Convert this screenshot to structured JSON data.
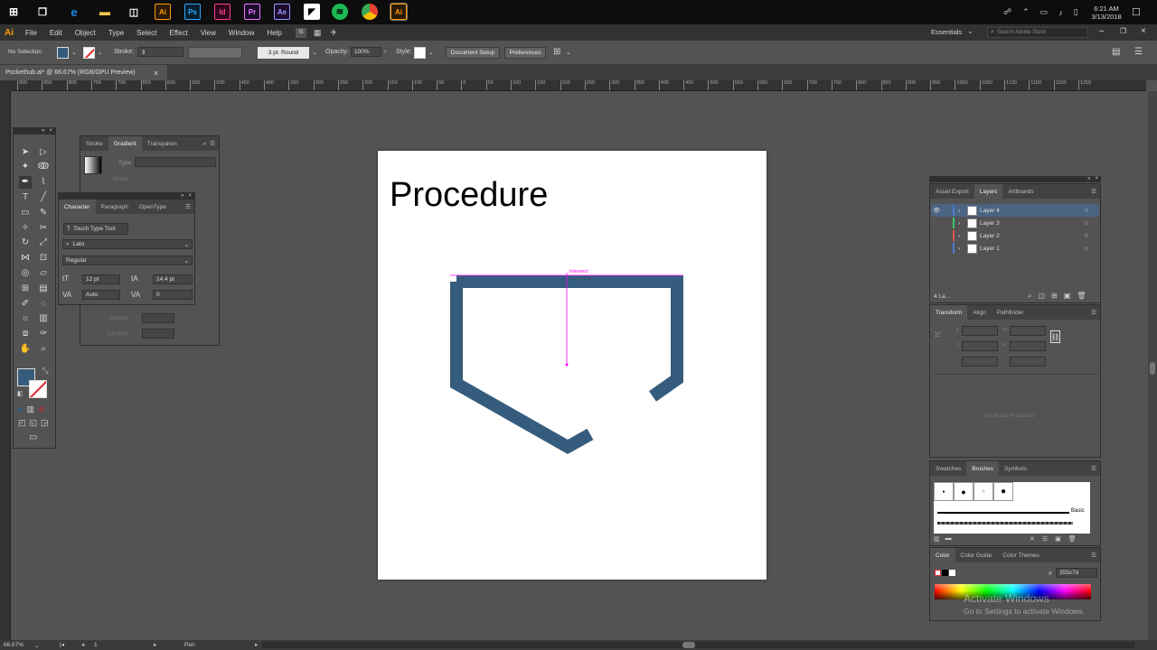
{
  "taskbar": {
    "apps": [
      "Ai",
      "Ps",
      "Id",
      "Pr",
      "Ae",
      "Ai"
    ],
    "time": "6:21 AM",
    "date": "3/13/2018"
  },
  "menubar": {
    "logo": "Ai",
    "items": [
      "File",
      "Edit",
      "Object",
      "Type",
      "Select",
      "Effect",
      "View",
      "Window",
      "Help"
    ],
    "workspace": "Essentials",
    "search_placeholder": "Search Adobe Stock"
  },
  "controlbar": {
    "selection": "No Selection",
    "stroke_label": "Stroke:",
    "brush": "3 pt. Round",
    "opacity_label": "Opacity:",
    "opacity_value": "100%",
    "style_label": "Style:",
    "document_setup": "Document Setup",
    "preferences": "Preferences"
  },
  "document": {
    "tab": "Pockethub.ai* @ 66.67% (RGB/GPU Preview)",
    "close": "×"
  },
  "ruler": {
    "ticks": [
      "900",
      "850",
      "800",
      "750",
      "700",
      "650",
      "600",
      "550",
      "500",
      "450",
      "400",
      "350",
      "300",
      "250",
      "200",
      "150",
      "100",
      "50",
      "0",
      "50",
      "100",
      "150",
      "200",
      "250",
      "300",
      "350",
      "400",
      "450",
      "500",
      "550",
      "600",
      "650",
      "700",
      "750",
      "800",
      "850",
      "900",
      "950",
      "1000",
      "1050",
      "1100",
      "1150",
      "1200",
      "1250"
    ]
  },
  "canvas": {
    "title": "Procedure",
    "smart_guide": "intersect",
    "shape_color": "#355c7d"
  },
  "gradient_panel": {
    "tabs": [
      "Stroke",
      "Gradient",
      "Transparen"
    ],
    "type_label": "Type:",
    "stroke_label": "Stroke:",
    "opacity_label": "Opacity:",
    "location_label": "Location:"
  },
  "character_panel": {
    "tabs": [
      "Character",
      "Paragraph",
      "OpenType"
    ],
    "touch_type": "Touch Type Tool",
    "font": "Lato",
    "style": "Regular",
    "size": "12 pt",
    "leading": "14.4 pt",
    "kerning": "Auto",
    "tracking": "0"
  },
  "layers_panel": {
    "tabs": [
      "Asset Export",
      "Layers",
      "Artboards"
    ],
    "layers": [
      {
        "name": "Layer 4",
        "color": "#4f7bd9",
        "selected": true
      },
      {
        "name": "Layer 3",
        "color": "#41c765",
        "selected": false
      },
      {
        "name": "Layer 2",
        "color": "#e0574c",
        "selected": false
      },
      {
        "name": "Layer 1",
        "color": "#4f7bd9",
        "selected": false
      }
    ],
    "count": "4 La..."
  },
  "transform_panel": {
    "tabs": [
      "Transform",
      "Align",
      "Pathfinder"
    ],
    "x_label": "X:",
    "y_label": "Y:",
    "w_label": "W:",
    "h_label": "H:",
    "empty": "No Shape Properties"
  },
  "brushes_panel": {
    "tabs": [
      "Swatches",
      "Brushes",
      "Symbols"
    ],
    "basic": "Basic"
  },
  "color_panel": {
    "tabs": [
      "Color",
      "Color Guide",
      "Color Themes"
    ],
    "hex_label": "#",
    "hex": "355c7d"
  },
  "watermark": {
    "title": "Activate Windows",
    "subtitle": "Go to Settings to activate Windows."
  },
  "status": {
    "zoom": "66.67%",
    "artboard": "1",
    "tool": "Pen"
  }
}
